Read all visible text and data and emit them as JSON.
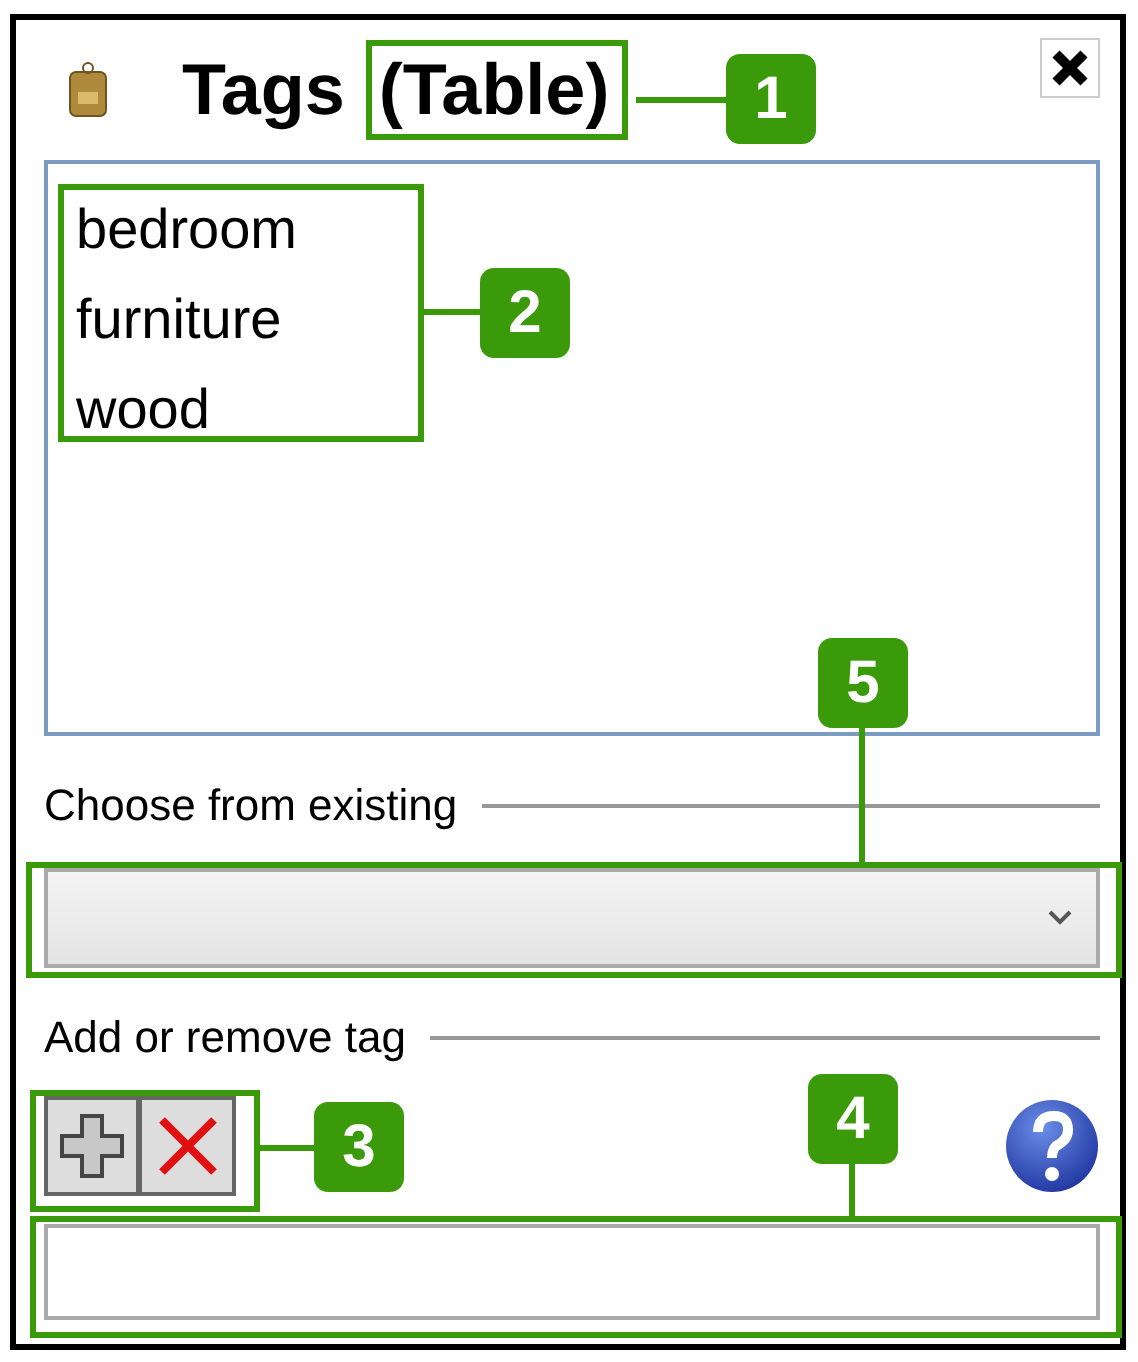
{
  "window": {
    "title": "Tags",
    "subtitle": "(Table)"
  },
  "tags": [
    "bedroom",
    "furniture",
    "wood"
  ],
  "sections": [
    {
      "label": "Choose from existing"
    },
    {
      "label": "Add or remove tag"
    }
  ],
  "callouts": [
    {
      "label": "1"
    },
    {
      "label": "2"
    },
    {
      "label": "3"
    },
    {
      "label": "4"
    },
    {
      "label": "5"
    }
  ]
}
